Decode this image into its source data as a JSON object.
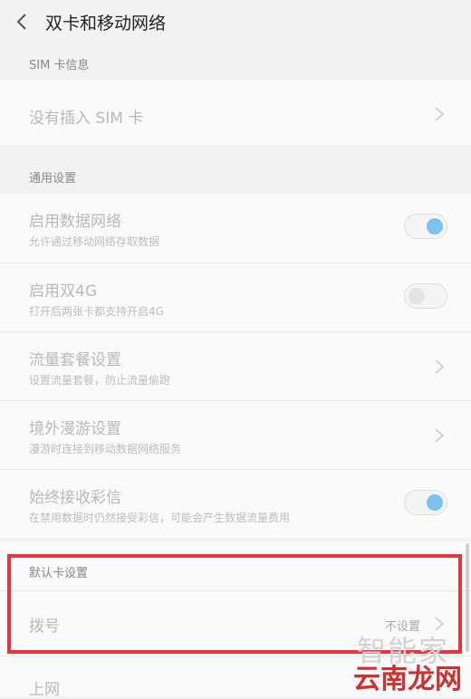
{
  "header": {
    "title": "双卡和移动网络"
  },
  "sim_section": {
    "title": "SIM 卡信息",
    "no_sim_label": "没有插入 SIM 卡"
  },
  "general_section": {
    "title": "通用设置",
    "items": [
      {
        "label": "启用数据网络",
        "desc": "允许通过移动网络存取数据",
        "toggle": "on"
      },
      {
        "label": "启用双4G",
        "desc": "打开后两张卡都支持开启4G",
        "toggle": "off"
      },
      {
        "label": "流量套餐设置",
        "desc": "设置流量套餐，防止流量偷跑"
      },
      {
        "label": "境外漫游设置",
        "desc": "漫游时连接到移动数据网络服务"
      },
      {
        "label": "始终接收彩信",
        "desc": "在禁用数据时仍然接受彩信，可能会产生数据流量费用",
        "toggle": "on"
      }
    ]
  },
  "default_section": {
    "title": "默认卡设置",
    "dial_label": "拨号",
    "dial_value": "不设置",
    "internet_label": "上网"
  },
  "watermark": {
    "line1": "智能家",
    "line2": "云南龙网"
  },
  "colors": {
    "toggle_on": "#7cc2ee",
    "highlight": "#e8343c"
  }
}
